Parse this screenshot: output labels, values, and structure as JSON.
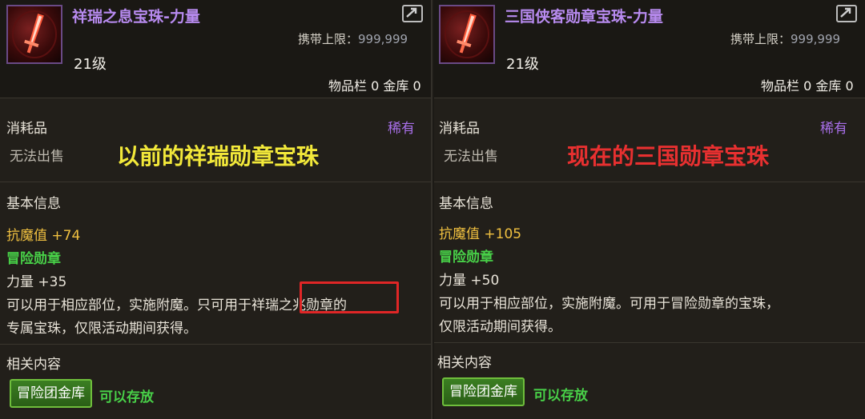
{
  "left": {
    "item_name": "祥瑞之息宝珠-力量",
    "carry_label": "携带上限：",
    "carry_value": "999,999",
    "level": "21级",
    "storage": "物品栏 0 金库 0",
    "category": "消耗品",
    "rarity": "稀有",
    "unsellable": "无法出售",
    "overlay_caption": "以前的祥瑞勋章宝珠",
    "section_basic": "基本信息",
    "stat_magic_resist": "抗魔值 +74",
    "medal_type": "冒险勋章",
    "stat_strength": "力量 +35",
    "desc_line1_a": "可以用于相应部位，实施附魔。只可用于",
    "desc_highlight": "祥瑞之兆勋章",
    "desc_line1_b": "的",
    "desc_line2": "专属宝珠，仅限活动期间获得。",
    "section_related": "相关内容",
    "vault_button": "冒险团金库",
    "storable": "可以存放"
  },
  "right": {
    "item_name": "三国侠客勋章宝珠-力量",
    "carry_label": "携带上限：",
    "carry_value": "999,999",
    "level": "21级",
    "storage": "物品栏 0 金库 0",
    "category": "消耗品",
    "rarity": "稀有",
    "unsellable": "无法出售",
    "overlay_caption": "现在的三国勋章宝珠",
    "section_basic": "基本信息",
    "stat_magic_resist": "抗魔值 +105",
    "medal_type": "冒险勋章",
    "stat_strength": "力量 +50",
    "desc_line1": "可以用于相应部位，实施附魔。可用于冒险勋章的宝珠，",
    "desc_line2": "仅限活动期间获得。",
    "section_related": "相关内容",
    "vault_button": "冒险团金库",
    "storable": "可以存放"
  },
  "colors": {
    "item_name": "#b88bf0",
    "rarity": "#a86fe8",
    "stat_gold": "#f0c040",
    "medal_green": "#48d048",
    "caption_left": "#f2e83a",
    "caption_right": "#e83030",
    "highlight_box": "#e02626"
  },
  "icons": [
    "red-orb-sword-icon",
    "share-icon"
  ]
}
